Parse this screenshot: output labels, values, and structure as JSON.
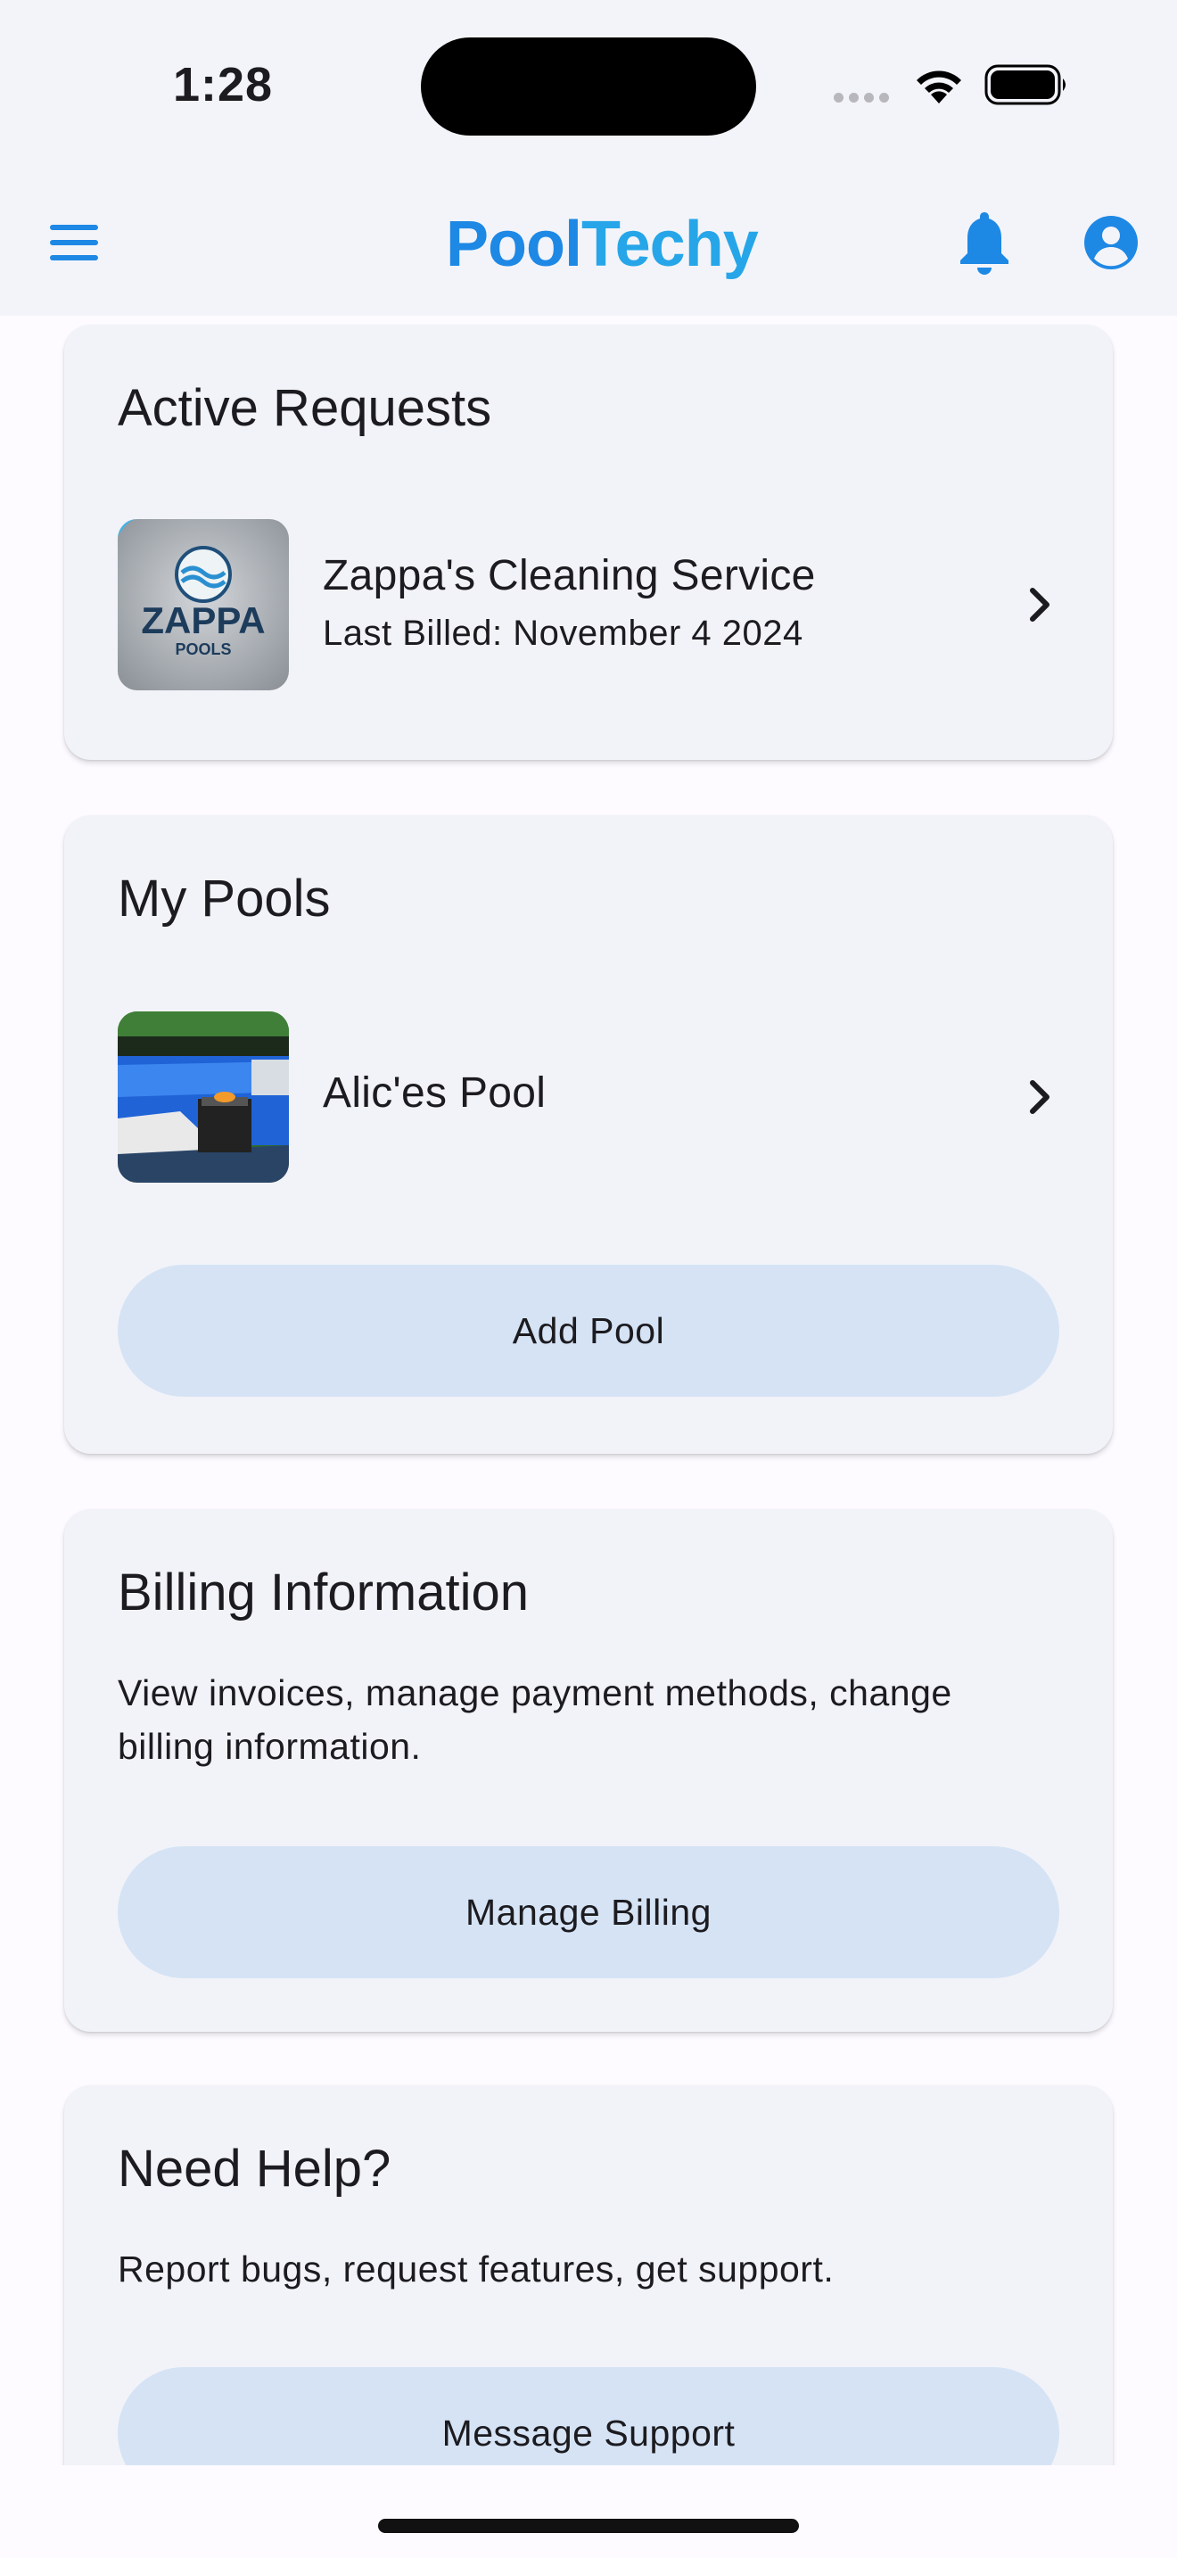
{
  "status_bar": {
    "time": "1:28"
  },
  "app_bar": {
    "logo_part1": "Pool",
    "logo_part2": "Techy"
  },
  "active_requests": {
    "title": "Active Requests",
    "items": [
      {
        "name": "Zappa's Cleaning Service",
        "subtitle": "Last Billed: November 4 2024",
        "logo_text": "ZAPPA",
        "logo_subtext": "POOLS"
      }
    ]
  },
  "my_pools": {
    "title": "My Pools",
    "items": [
      {
        "name": "Alic'es Pool"
      }
    ],
    "add_button": "Add Pool"
  },
  "billing": {
    "title": "Billing Information",
    "description": "View invoices, manage payment methods, change billing information.",
    "button": "Manage Billing"
  },
  "help": {
    "title": "Need Help?",
    "description": "Report bugs, request features, get support.",
    "button": "Message Support"
  },
  "colors": {
    "primary": "#1e88e5",
    "card_bg": "#f2f3f8",
    "button_bg": "#d5e3f5"
  }
}
